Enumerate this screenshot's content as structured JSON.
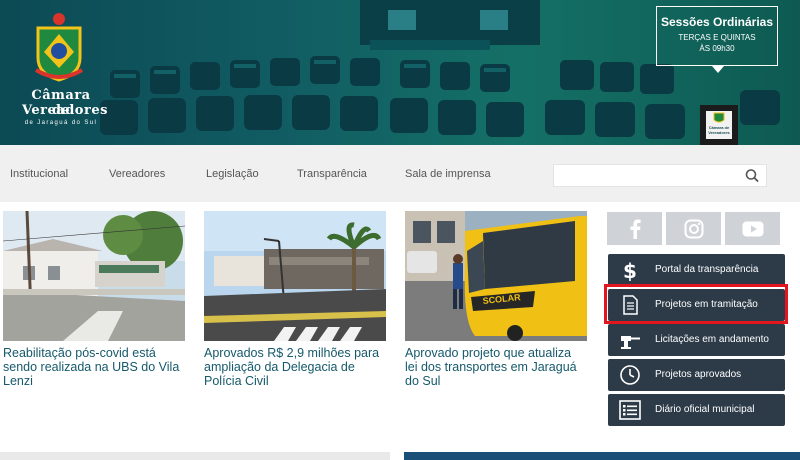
{
  "header": {
    "logo": {
      "line1": "Câmara de",
      "line2": "Vereadores",
      "line3": "de Jaraguá do Sul"
    },
    "sessions": {
      "title": "Sessões Ordinárias",
      "days": "TERÇAS E QUINTAS",
      "time": "ÀS 09h30"
    },
    "podium_text": "Câmara de Vereadores"
  },
  "nav": {
    "items": [
      "Institucional",
      "Vereadores",
      "Legislação",
      "Transparência",
      "Sala de imprensa"
    ],
    "search_placeholder": ""
  },
  "news": [
    {
      "title": "Reabilitação pós-covid está sendo realizada na UBS do Vila Lenzi"
    },
    {
      "title": "Aprovados R$ 2,9 milhões para ampliação da Delegacia de Polícia Civil"
    },
    {
      "title": "Aprovado projeto que atualiza lei dos transportes em Jaraguá do Sul"
    }
  ],
  "social": [
    "facebook-icon",
    "instagram-icon",
    "youtube-icon"
  ],
  "side_links": [
    {
      "label": "Portal da transparência",
      "icon": "dollar-icon"
    },
    {
      "label": "Projetos em tramitação",
      "icon": "document-icon",
      "highlighted": true
    },
    {
      "label": "Licitações em andamento",
      "icon": "gavel-icon"
    },
    {
      "label": "Projetos aprovados",
      "icon": "clock-icon"
    },
    {
      "label": "Diário oficial municipal",
      "icon": "list-icon"
    }
  ],
  "colors": {
    "hero": "#115c63",
    "nav_bg": "#f0f0f0",
    "news_title": "#16596b",
    "side_bg": "#2d3b48",
    "highlight": "#e3151f",
    "social_bg": "#cfd3d8"
  }
}
